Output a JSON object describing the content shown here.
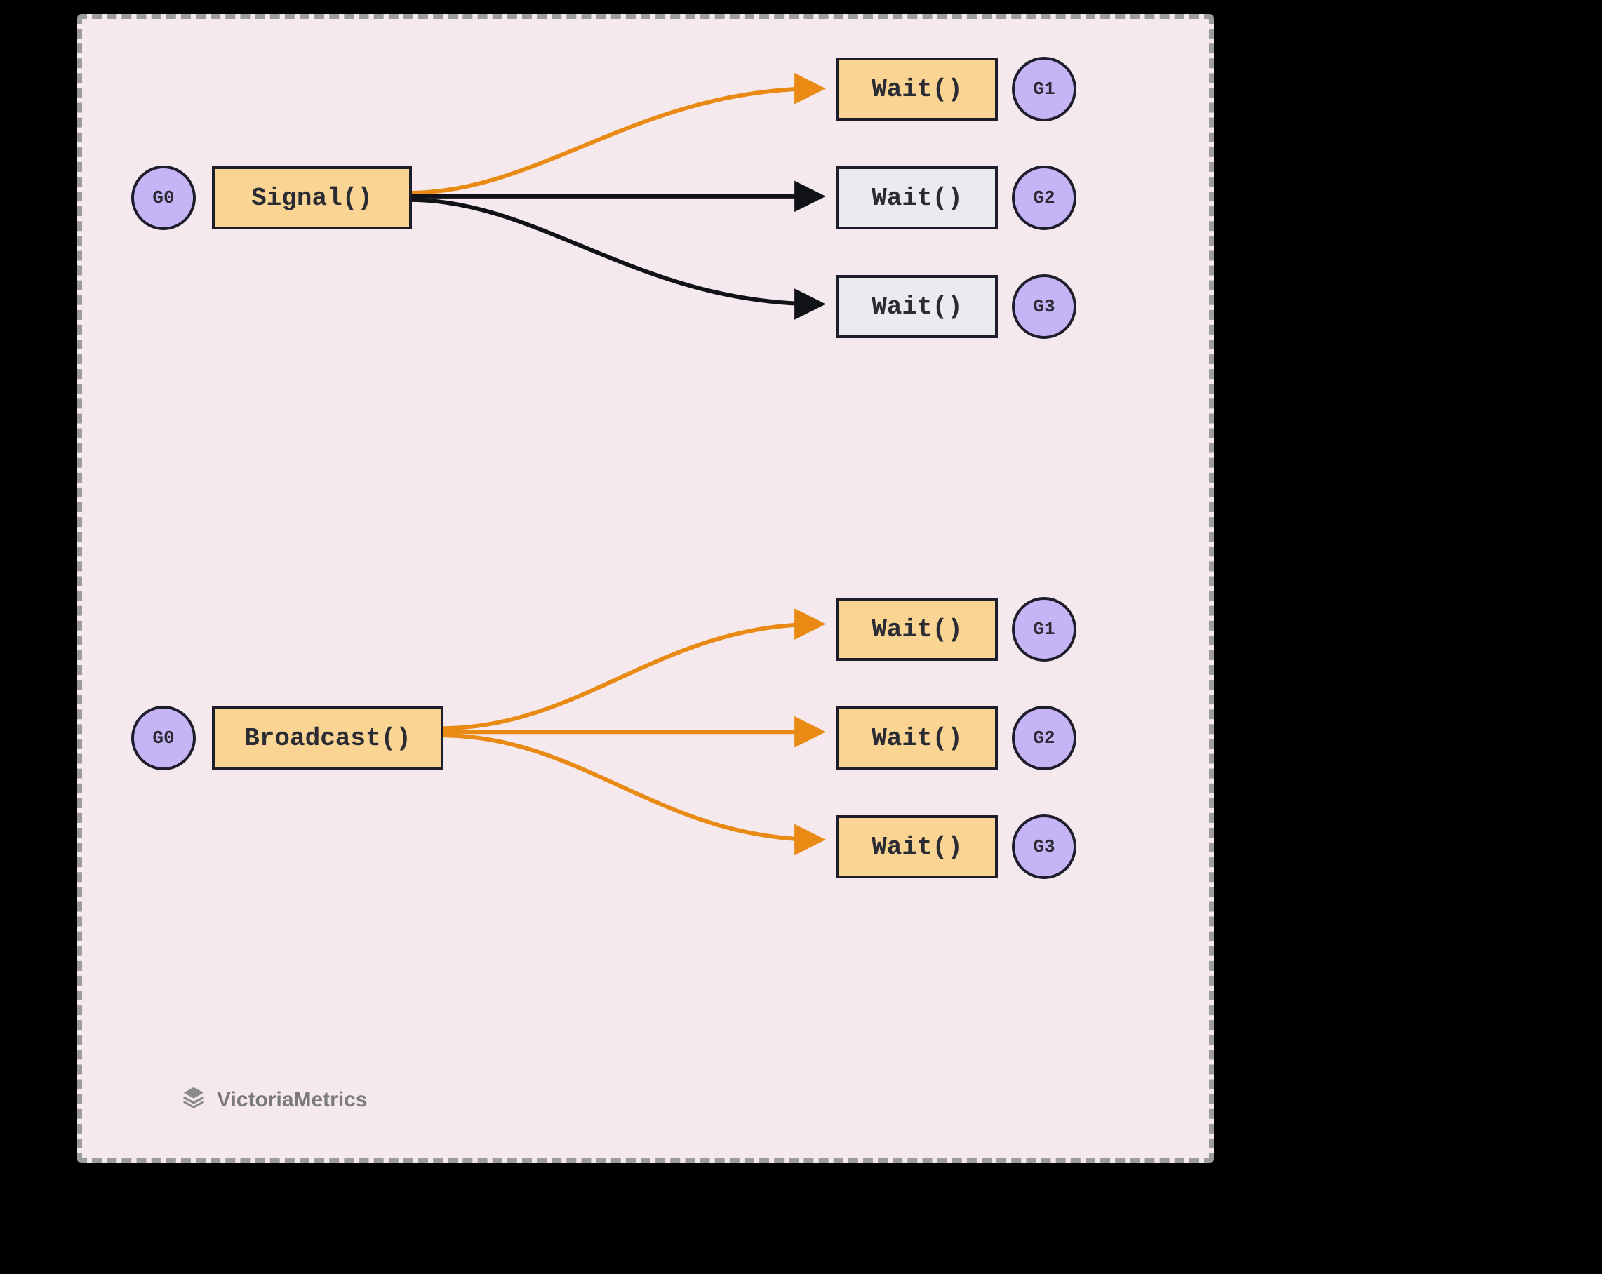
{
  "diagram": {
    "signal": {
      "sender": {
        "goroutine": "G0",
        "method": "Signal()"
      },
      "receivers": [
        {
          "goroutine": "G1",
          "method": "Wait()",
          "activated": true
        },
        {
          "goroutine": "G2",
          "method": "Wait()",
          "activated": false
        },
        {
          "goroutine": "G3",
          "method": "Wait()",
          "activated": false
        }
      ]
    },
    "broadcast": {
      "sender": {
        "goroutine": "G0",
        "method": "Broadcast()"
      },
      "receivers": [
        {
          "goroutine": "G1",
          "method": "Wait()",
          "activated": true
        },
        {
          "goroutine": "G2",
          "method": "Wait()",
          "activated": true
        },
        {
          "goroutine": "G3",
          "method": "Wait()",
          "activated": true
        }
      ]
    }
  },
  "colors": {
    "active_arrow": "#e98a14",
    "inactive_arrow": "#111118",
    "active_box": "#f9d493",
    "inactive_box": "#e9ebee",
    "goroutine_circle": "#c6b5f6",
    "panel_bg": "#f5e9ee"
  },
  "branding": {
    "label": "VictoriaMetrics"
  }
}
